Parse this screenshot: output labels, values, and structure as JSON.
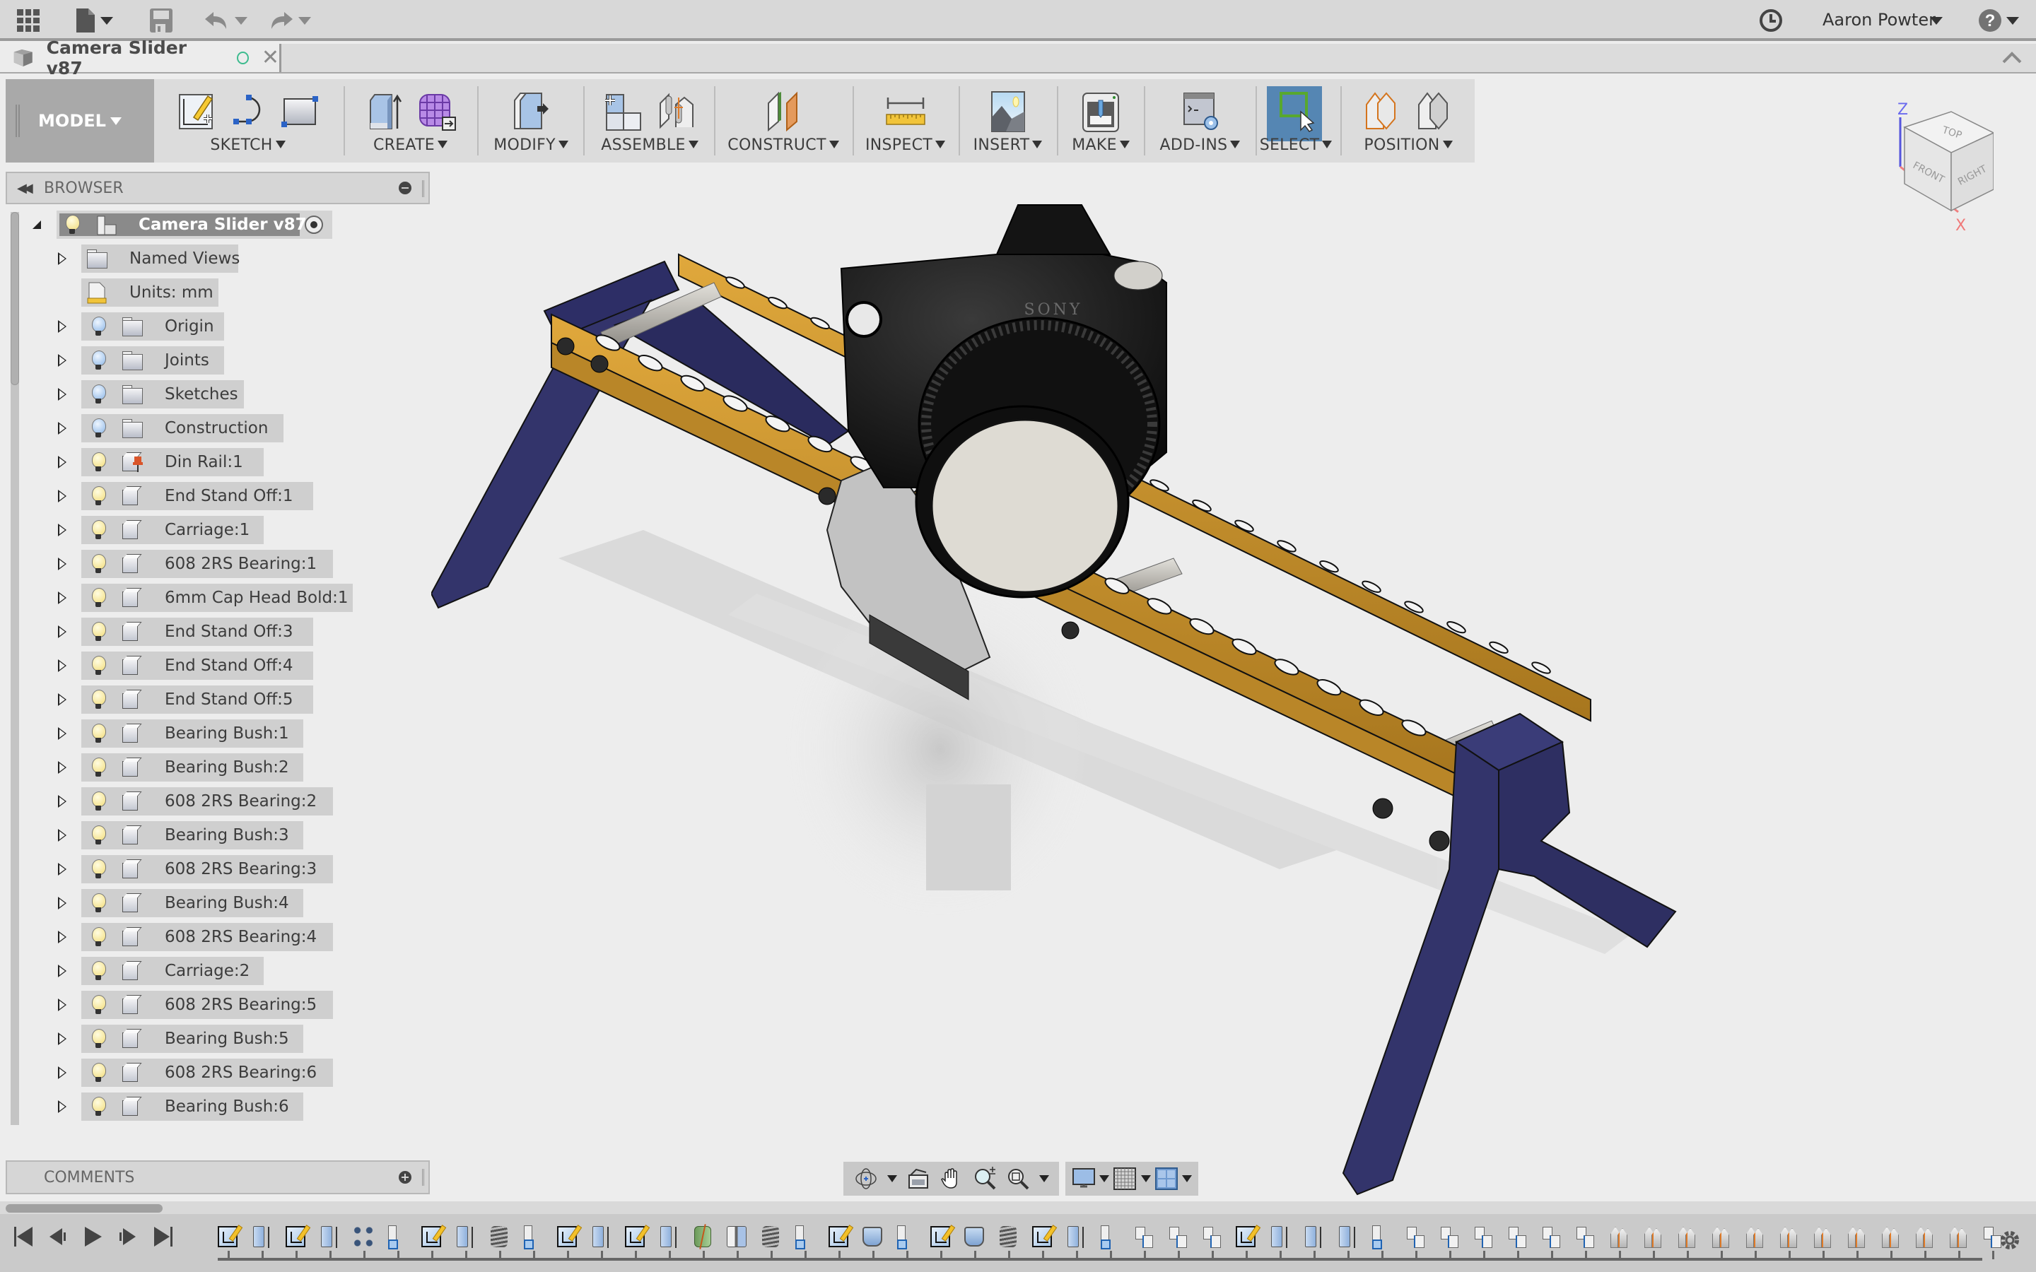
{
  "app": {
    "user_name": "Aaron Powter",
    "icons": {
      "apps": "apps-grid-icon",
      "file": "file-icon",
      "save": "save-icon",
      "undo": "undo-icon",
      "redo": "redo-icon",
      "job_status": "clock-icon",
      "help": "help-icon"
    }
  },
  "document_tab": {
    "title": "Camera Slider v87",
    "status": "saved-indicator",
    "close": "✕",
    "collapse": "^"
  },
  "ribbon": {
    "workspace": "MODEL",
    "groups": [
      {
        "label": "SKETCH",
        "icons": [
          "create-sketch-icon",
          "arc-icon",
          "rectangle-icon"
        ]
      },
      {
        "label": "CREATE",
        "icons": [
          "extrude-icon",
          "create-form-icon"
        ]
      },
      {
        "label": "MODIFY",
        "icons": [
          "press-pull-icon"
        ]
      },
      {
        "label": "ASSEMBLE",
        "icons": [
          "new-component-icon",
          "joint-icon"
        ]
      },
      {
        "label": "CONSTRUCT",
        "icons": [
          "offset-plane-icon"
        ]
      },
      {
        "label": "INSPECT",
        "icons": [
          "measure-icon"
        ]
      },
      {
        "label": "INSERT",
        "icons": [
          "insert-image-icon"
        ]
      },
      {
        "label": "MAKE",
        "icons": [
          "3d-print-icon"
        ]
      },
      {
        "label": "ADD-INS",
        "icons": [
          "scripts-addins-icon"
        ]
      },
      {
        "label": "SELECT",
        "icons": [
          "select-icon"
        ]
      },
      {
        "label": "POSITION",
        "icons": [
          "capture-position-icon",
          "revert-position-icon"
        ]
      }
    ]
  },
  "browser": {
    "title": "BROWSER",
    "root": {
      "label": "Camera Slider v87",
      "expanded": true,
      "visible": true
    },
    "items": [
      {
        "label": "Named Views",
        "icon": "folder",
        "visible": null,
        "bulb": null,
        "expandable": true
      },
      {
        "label": "Units: mm",
        "icon": "units",
        "visible": null,
        "bulb": null,
        "expandable": false
      },
      {
        "label": "Origin",
        "icon": "folder",
        "bulb": "blue",
        "expandable": true
      },
      {
        "label": "Joints",
        "icon": "folder",
        "bulb": "blue",
        "expandable": true
      },
      {
        "label": "Sketches",
        "icon": "folder",
        "bulb": "blue",
        "expandable": true
      },
      {
        "label": "Construction",
        "icon": "folder",
        "bulb": "blue",
        "expandable": true
      },
      {
        "label": "Din Rail:1",
        "icon": "grounded-component",
        "bulb": "yellow",
        "expandable": true
      },
      {
        "label": "End Stand Off:1",
        "icon": "component",
        "bulb": "yellow",
        "expandable": true
      },
      {
        "label": "Carriage:1",
        "icon": "component",
        "bulb": "yellow",
        "expandable": true
      },
      {
        "label": "608 2RS Bearing:1",
        "icon": "component",
        "bulb": "yellow",
        "expandable": true
      },
      {
        "label": "6mm Cap Head Bold:1",
        "icon": "component",
        "bulb": "yellow",
        "expandable": true
      },
      {
        "label": "End Stand Off:3",
        "icon": "component",
        "bulb": "yellow",
        "expandable": true
      },
      {
        "label": "End Stand Off:4",
        "icon": "component",
        "bulb": "yellow",
        "expandable": true
      },
      {
        "label": "End Stand Off:5",
        "icon": "component",
        "bulb": "yellow",
        "expandable": true
      },
      {
        "label": "Bearing Bush:1",
        "icon": "component",
        "bulb": "yellow",
        "expandable": true
      },
      {
        "label": "Bearing Bush:2",
        "icon": "component",
        "bulb": "yellow",
        "expandable": true
      },
      {
        "label": "608 2RS Bearing:2",
        "icon": "component",
        "bulb": "yellow",
        "expandable": true
      },
      {
        "label": "Bearing Bush:3",
        "icon": "component",
        "bulb": "yellow",
        "expandable": true
      },
      {
        "label": "608 2RS Bearing:3",
        "icon": "component",
        "bulb": "yellow",
        "expandable": true
      },
      {
        "label": "Bearing Bush:4",
        "icon": "component",
        "bulb": "yellow",
        "expandable": true
      },
      {
        "label": "608 2RS Bearing:4",
        "icon": "component",
        "bulb": "yellow",
        "expandable": true
      },
      {
        "label": "Carriage:2",
        "icon": "component",
        "bulb": "yellow",
        "expandable": true
      },
      {
        "label": "608 2RS Bearing:5",
        "icon": "component",
        "bulb": "yellow",
        "expandable": true
      },
      {
        "label": "Bearing Bush:5",
        "icon": "component",
        "bulb": "yellow",
        "expandable": true
      },
      {
        "label": "608 2RS Bearing:6",
        "icon": "component",
        "bulb": "yellow",
        "expandable": true
      },
      {
        "label": "Bearing Bush:6",
        "icon": "component",
        "bulb": "yellow",
        "expandable": true
      }
    ]
  },
  "comments": {
    "title": "COMMENTS"
  },
  "viewcube": {
    "top": "TOP",
    "front": "FRONT",
    "right": "RIGHT",
    "axis_z": "Z",
    "axis_x": "X"
  },
  "viewport": {
    "model_colors": {
      "rail": "#c9922e",
      "legs": "#33346b",
      "camera": "#151515",
      "lens_cap": "#dedbd3",
      "rods": "#b7b4ad",
      "carriage": "#c2c2c2"
    },
    "camera_brand": "SONY"
  },
  "nav_bar": {
    "items": [
      "orbit-icon",
      "look-at-icon",
      "pan-icon",
      "zoom-icon",
      "fit-icon"
    ],
    "display": [
      "display-settings-icon",
      "grid-settings-icon",
      "viewports-icon"
    ]
  },
  "timeline": {
    "controls": [
      "go-to-start-icon",
      "step-back-icon",
      "play-icon",
      "step-forward-icon",
      "go-to-end-icon"
    ],
    "features": [
      "sketch",
      "extrude",
      "sketch",
      "extrude",
      "pattern",
      "component",
      "sketch",
      "extrude",
      "thread",
      "component",
      "sketch",
      "extrude",
      "sketch",
      "extrude",
      "combine",
      "mirror",
      "thread",
      "component",
      "sketch",
      "revolve",
      "component",
      "sketch",
      "revolve",
      "thread",
      "sketch",
      "extrude",
      "component",
      "joint",
      "joint",
      "joint",
      "sketch",
      "extrude",
      "extrude",
      "extrude",
      "component",
      "joint",
      "joint",
      "joint",
      "joint",
      "joint",
      "joint",
      "position",
      "position",
      "position",
      "position",
      "position",
      "position",
      "position",
      "position",
      "position",
      "position",
      "position",
      "joint"
    ]
  }
}
